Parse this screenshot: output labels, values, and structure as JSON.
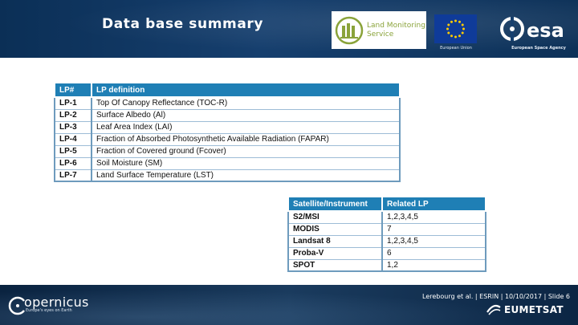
{
  "header": {
    "title": "Data base summary",
    "lms_logo_line1": "Land Monitoring",
    "lms_logo_line2": "Service",
    "eu_caption": "European Union",
    "esa_caption": "European Space Agency",
    "esa_word": "esa"
  },
  "lp_table": {
    "headers": [
      "LP#",
      "LP definition"
    ],
    "rows": [
      [
        "LP-1",
        "Top Of Canopy Reflectance (TOC-R)"
      ],
      [
        "LP-2",
        "Surface Albedo (Al)"
      ],
      [
        "LP-3",
        "Leaf Area Index (LAI)"
      ],
      [
        "LP-4",
        "Fraction of Absorbed Photosynthetic Available Radiation (FAPAR)"
      ],
      [
        "LP-5",
        "Fraction of Covered ground (Fcover)"
      ],
      [
        "LP-6",
        "Soil Moisture (SM)"
      ],
      [
        "LP-7",
        "Land Surface Temperature (LST)"
      ]
    ]
  },
  "sat_table": {
    "headers": [
      "Satellite/Instrument",
      "Related LP"
    ],
    "rows": [
      [
        "S2/MSI",
        "1,2,3,4,5"
      ],
      [
        "MODIS",
        "7"
      ],
      [
        "Landsat 8",
        "1,2,3,4,5"
      ],
      [
        "Proba-V",
        "6"
      ],
      [
        "SPOT",
        "1,2"
      ]
    ]
  },
  "footer": {
    "copernicus_name": "opernicus",
    "copernicus_tagline": "Europe's eyes on Earth",
    "slide_info": "Lerebourg et al. | ESRIN | 10/10/2017 | Slide 6",
    "eumetsat": "EUMETSAT"
  },
  "colors": {
    "table_header": "#1f7fb5",
    "table_border": "#6e9bbd",
    "banner": "#163f6e",
    "lms_green": "#8aa33a",
    "eu_blue": "#0f3b99",
    "eu_star": "#ffcc00"
  }
}
